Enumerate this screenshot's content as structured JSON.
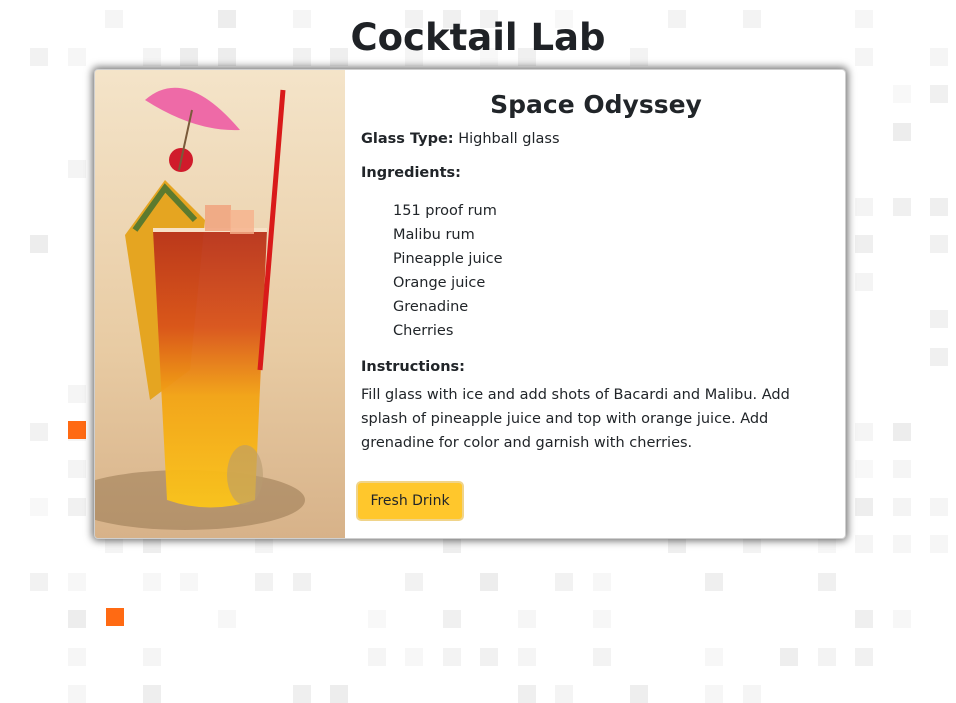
{
  "app": {
    "title": "Cocktail Lab"
  },
  "drink": {
    "name": "Space Odyssey",
    "glass_label": "Glass Type:",
    "glass_value": "Highball glass",
    "ingredients_label": "Ingredients:",
    "ingredients": [
      "151 proof rum",
      "Malibu rum",
      "Pineapple juice",
      "Orange juice",
      "Grenadine",
      "Cherries"
    ],
    "instructions_label": "Instructions:",
    "instructions": "Fill glass with ice and add shots of Bacardi and Malibu. Add splash of pineapple juice and top with orange juice. Add grenadine for color and garnish with cherries."
  },
  "actions": {
    "fresh_label": "Fresh Drink"
  },
  "colors": {
    "accent_button": "#ffc72c",
    "pattern_orange": "#ff6a13",
    "pattern_gray": "#ececec"
  }
}
